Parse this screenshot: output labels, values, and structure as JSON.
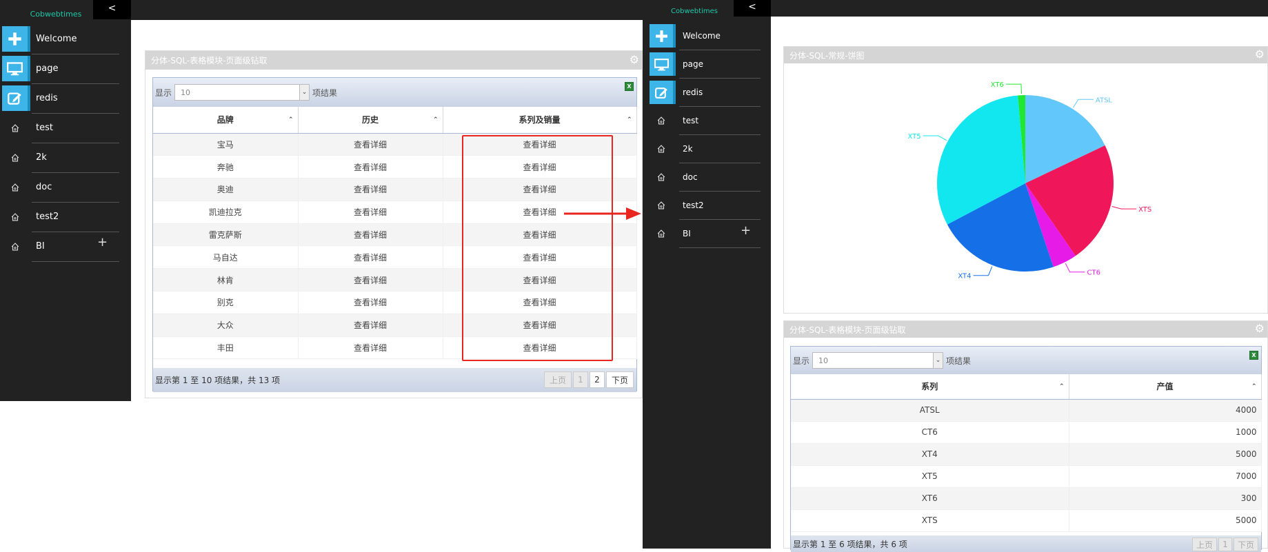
{
  "left_app": {
    "logo": "Cobwebtimes",
    "toggle": "<",
    "menu": [
      {
        "label": "Welcome",
        "icon": "plus-icon",
        "type": "primary"
      },
      {
        "label": "page",
        "icon": "monitor-icon",
        "type": "primary"
      },
      {
        "label": "redis",
        "icon": "edit-icon",
        "type": "primary"
      },
      {
        "label": "test",
        "icon": "home-icon",
        "type": "sub"
      },
      {
        "label": "2k",
        "icon": "home-icon",
        "type": "sub"
      },
      {
        "label": "doc",
        "icon": "home-icon",
        "type": "sub"
      },
      {
        "label": "test2",
        "icon": "home-icon",
        "type": "sub"
      },
      {
        "label": "BI",
        "icon": "home-icon",
        "type": "sub",
        "expand": "+"
      }
    ],
    "panel": {
      "title": "分体-SQL-表格模块-页面级钻取",
      "show_label": "显示",
      "page_size": "10",
      "result_label": "项结果",
      "columns": [
        "品牌",
        "历史",
        "系列及销量"
      ],
      "rows": [
        [
          "宝马",
          "查看详细",
          "查看详细"
        ],
        [
          "奔驰",
          "查看详细",
          "查看详细"
        ],
        [
          "奥迪",
          "查看详细",
          "查看详细"
        ],
        [
          "凯迪拉克",
          "查看详细",
          "查看详细"
        ],
        [
          "雷克萨斯",
          "查看详细",
          "查看详细"
        ],
        [
          "马自达",
          "查看详细",
          "查看详细"
        ],
        [
          "林肯",
          "查看详细",
          "查看详细"
        ],
        [
          "别克",
          "查看详细",
          "查看详细"
        ],
        [
          "大众",
          "查看详细",
          "查看详细"
        ],
        [
          "丰田",
          "查看详细",
          "查看详细"
        ]
      ],
      "footer": "显示第 1 至 10 项结果，共 13 项",
      "pager": {
        "prev": "上页",
        "pages": [
          "1",
          "2"
        ],
        "next": "下页"
      }
    }
  },
  "right_app": {
    "logo": "Cobwebtimes",
    "toggle": "<",
    "menu": [
      {
        "label": "Welcome",
        "icon": "plus-icon",
        "type": "primary"
      },
      {
        "label": "page",
        "icon": "monitor-icon",
        "type": "primary"
      },
      {
        "label": "redis",
        "icon": "edit-icon",
        "type": "primary"
      },
      {
        "label": "test",
        "icon": "home-icon",
        "type": "sub"
      },
      {
        "label": "2k",
        "icon": "home-icon",
        "type": "sub"
      },
      {
        "label": "doc",
        "icon": "home-icon",
        "type": "sub"
      },
      {
        "label": "test2",
        "icon": "home-icon",
        "type": "sub"
      },
      {
        "label": "BI",
        "icon": "home-icon",
        "type": "sub",
        "expand": "+"
      }
    ],
    "pie_panel": {
      "title": "分体-SQL-常规-饼图"
    },
    "table_panel": {
      "title": "分体-SQL-表格模块-页面级钻取",
      "show_label": "显示",
      "page_size": "10",
      "result_label": "项结果",
      "columns": [
        "系列",
        "产值"
      ],
      "rows": [
        [
          "ATSL",
          "4000"
        ],
        [
          "CT6",
          "1000"
        ],
        [
          "XT4",
          "5000"
        ],
        [
          "XT5",
          "7000"
        ],
        [
          "XT6",
          "300"
        ],
        [
          "XTS",
          "5000"
        ]
      ],
      "footer": "显示第 1 至 6 项结果，共 6 项",
      "pager": {
        "prev": "上页",
        "pages": [
          "1"
        ],
        "next": "下页"
      }
    }
  },
  "chart_data": {
    "type": "pie",
    "title": "",
    "slices": [
      {
        "label": "ATSL",
        "value": 4000,
        "color": "#62c8fb"
      },
      {
        "label": "XTS",
        "value": 5000,
        "color": "#f0165a"
      },
      {
        "label": "CT6",
        "value": 1000,
        "color": "#e61be8"
      },
      {
        "label": "XT4",
        "value": 5000,
        "color": "#1570e8"
      },
      {
        "label": "XT5",
        "value": 7000,
        "color": "#12e6ee"
      },
      {
        "label": "XT6",
        "value": 300,
        "color": "#20e832"
      }
    ]
  },
  "colors": {
    "sidebar_bg": "#222222",
    "accent_square": "#3eb5e8",
    "logo": "#1dc9a9",
    "highlight_box": "#e8251f"
  }
}
